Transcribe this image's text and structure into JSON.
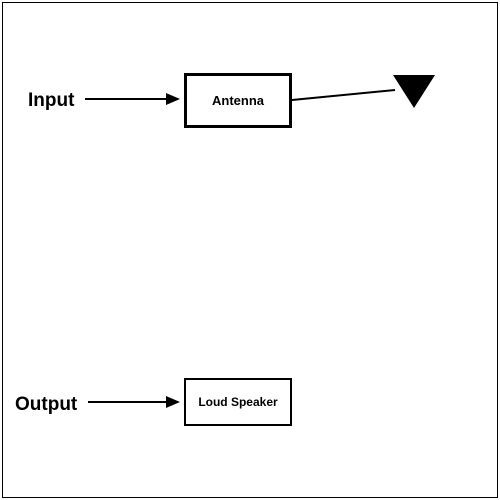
{
  "labels": {
    "input": "Input",
    "output": "Output"
  },
  "boxes": {
    "antenna": "Antenna",
    "speaker": "Loud Speaker"
  }
}
